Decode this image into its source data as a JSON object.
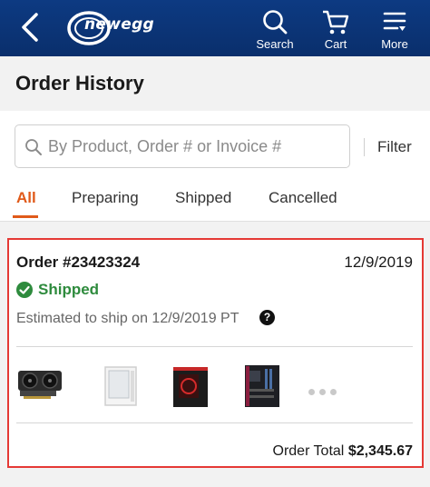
{
  "header": {
    "logo_text": "newegg",
    "nav": [
      {
        "label": "Search",
        "icon": "search-icon"
      },
      {
        "label": "Cart",
        "icon": "cart-icon"
      },
      {
        "label": "More",
        "icon": "menu-icon"
      }
    ],
    "colors": {
      "bar": "#0d3a82"
    }
  },
  "page": {
    "title": "Order History"
  },
  "search": {
    "placeholder": "By Product, Order # or Invoice #",
    "filter_label": "Filter"
  },
  "tabs": [
    {
      "label": "All",
      "active": true
    },
    {
      "label": "Preparing",
      "active": false
    },
    {
      "label": "Shipped",
      "active": false
    },
    {
      "label": "Cancelled",
      "active": false
    }
  ],
  "order": {
    "number": "Order #23423324",
    "date": "12/9/2019",
    "status": "Shipped",
    "eta": "Estimated to ship on 12/9/2019 PT",
    "help": "?",
    "products": [
      {
        "icon": "graphics-card-icon"
      },
      {
        "icon": "white-pc-case-icon"
      },
      {
        "icon": "black-red-pc-case-icon"
      },
      {
        "icon": "motherboard-icon"
      }
    ],
    "more_icon": "more-dots-icon",
    "total_label": "Order Total",
    "total_value": "$2,345.67",
    "colors": {
      "status": "#2e8b3d",
      "highlight_border": "#e53935",
      "accent": "#e05a1a"
    }
  }
}
